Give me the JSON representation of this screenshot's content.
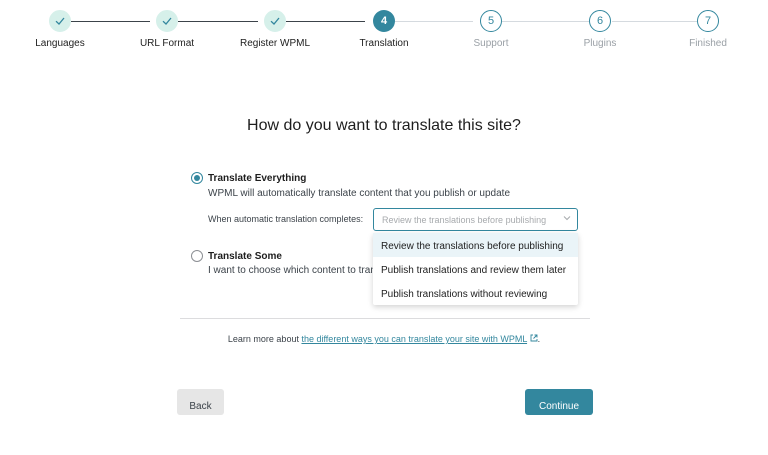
{
  "stepper": {
    "steps": [
      {
        "label": "Languages",
        "number": "1",
        "status": "done"
      },
      {
        "label": "URL Format",
        "number": "2",
        "status": "done"
      },
      {
        "label": "Register WPML",
        "number": "3",
        "status": "done"
      },
      {
        "label": "Translation",
        "number": "4",
        "status": "active"
      },
      {
        "label": "Support",
        "number": "5",
        "status": "todo"
      },
      {
        "label": "Plugins",
        "number": "6",
        "status": "todo"
      },
      {
        "label": "Finished",
        "number": "7",
        "status": "todo"
      }
    ]
  },
  "heading": "How do you want to translate this site?",
  "options": {
    "everything": {
      "title": "Translate Everything",
      "description": "WPML will automatically translate content that you publish or update",
      "checked": true
    },
    "some": {
      "title": "Translate Some",
      "description": "I want to choose which content to tran",
      "checked": false
    }
  },
  "auto_translation": {
    "label": "When automatic translation completes:",
    "selected": "Review the translations before publishing",
    "options": [
      "Review the translations before publishing",
      "Publish translations and review them later",
      "Publish translations without reviewing"
    ]
  },
  "learn_more": {
    "prefix": "Learn more about ",
    "link": "the different ways you can translate your site with WPML",
    "suffix": "."
  },
  "buttons": {
    "back": "Back",
    "continue": "Continue"
  },
  "colors": {
    "accent": "#33879e",
    "done_bg": "#d6f0ea"
  }
}
